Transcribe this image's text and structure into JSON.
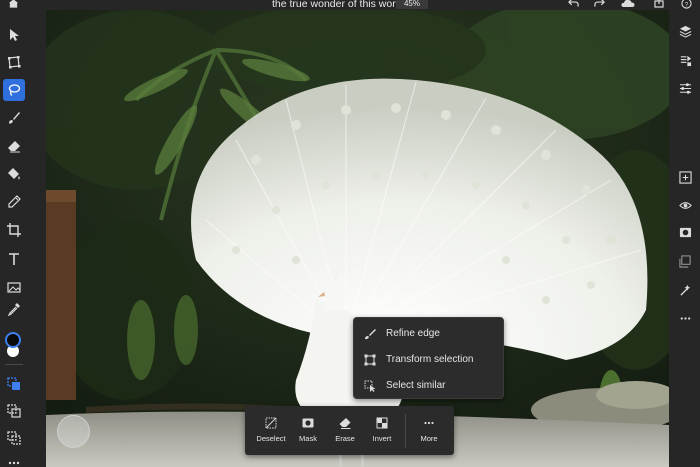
{
  "topbar": {
    "title": "the true wonder of this world",
    "zoom": "45%",
    "icons": [
      "home-icon",
      "undo-icon",
      "redo-icon",
      "cloud-icon",
      "share-icon",
      "help-icon"
    ]
  },
  "tools": [
    "select-arrow-icon",
    "transform-icon",
    "lasso-icon",
    "brush-icon",
    "eraser-icon",
    "fill-icon",
    "healing-icon",
    "crop-icon",
    "type-icon",
    "place-image-icon",
    "eyedropper-icon",
    "selection-add-icon",
    "selection-subtract-icon",
    "selection-intersect-icon",
    "more-icon"
  ],
  "colors": {
    "accent": "#2f6fde",
    "foreground_swatch": "#0b0b0b",
    "background_swatch": "#ffffff",
    "panel": "#262626"
  },
  "rightpanel": {
    "icons": [
      "layers-icon",
      "layer-properties-icon",
      "adjustments-icon",
      "add-layer-icon",
      "visibility-icon",
      "mask-icon",
      "clipping-icon",
      "effects-icon",
      "more-icon"
    ]
  },
  "context_menu": {
    "items": [
      {
        "label": "Refine edge",
        "icon": "refine-edge-icon"
      },
      {
        "label": "Transform selection",
        "icon": "transform-selection-icon"
      },
      {
        "label": "Select similar",
        "icon": "select-similar-icon"
      }
    ]
  },
  "taskbar": {
    "items": [
      {
        "label": "Deselect",
        "icon": "deselect-icon"
      },
      {
        "label": "Mask",
        "icon": "mask-icon"
      },
      {
        "label": "Erase",
        "icon": "erase-icon"
      },
      {
        "label": "Invert",
        "icon": "invert-icon"
      },
      {
        "label": "More",
        "icon": "more-icon"
      }
    ]
  }
}
